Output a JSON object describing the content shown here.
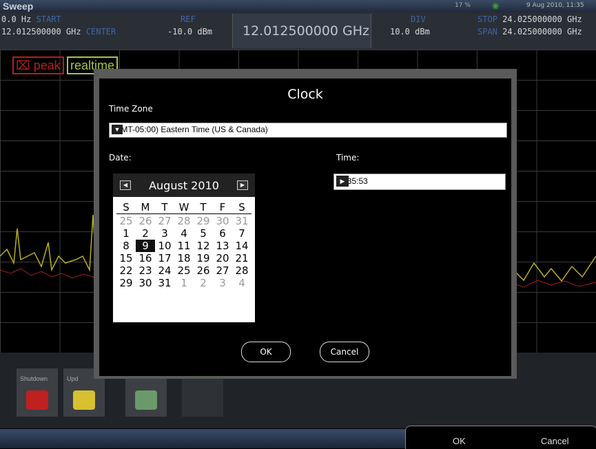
{
  "titlebar": {
    "title": "Sweep",
    "battery": "17 %",
    "datetime": "9 Aug 2010, 11:35"
  },
  "header": {
    "start_value": "0.0 Hz",
    "start_label": "START",
    "center_freq_value": "12.012500000 GHz",
    "center_label": "CENTER",
    "ref_label": "REF",
    "ref_value": "-10.0 dBm",
    "center_display": "12.012500000 GHz",
    "div_label": "DIV",
    "div_value": "10.0 dBm",
    "stop_label": "STOP",
    "stop_value": "24.025000000 GHz",
    "span_label": "SPAN",
    "span_value": "24.025000000 GHz"
  },
  "tags": {
    "peak": "peak",
    "realtime": "realtime"
  },
  "bottom_buttons": {
    "shutdown": "Shutdown",
    "update": "Upd"
  },
  "bottom_bar": {
    "ok": "OK",
    "cancel": "Cancel"
  },
  "dialog": {
    "title": "Clock",
    "tz_label": "Time Zone",
    "tz_value": "(GMT-05:00) Eastern Time (US & Canada)",
    "date_label": "Date:",
    "time_label": "Time:",
    "time_value": "11:35:53",
    "ok": "OK",
    "cancel": "Cancel",
    "calendar": {
      "month": "August 2010",
      "weekdays": [
        "S",
        "M",
        "T",
        "W",
        "T",
        "F",
        "S"
      ],
      "weeks": [
        [
          "25",
          "26",
          "27",
          "28",
          "29",
          "30",
          "31"
        ],
        [
          "1",
          "2",
          "3",
          "4",
          "5",
          "6",
          "7"
        ],
        [
          "8",
          "9",
          "10",
          "11",
          "12",
          "13",
          "14"
        ],
        [
          "15",
          "16",
          "17",
          "18",
          "19",
          "20",
          "21"
        ],
        [
          "22",
          "23",
          "24",
          "25",
          "26",
          "27",
          "28"
        ],
        [
          "29",
          "30",
          "31",
          "1",
          "2",
          "3",
          "4"
        ]
      ],
      "selected": "9"
    }
  }
}
